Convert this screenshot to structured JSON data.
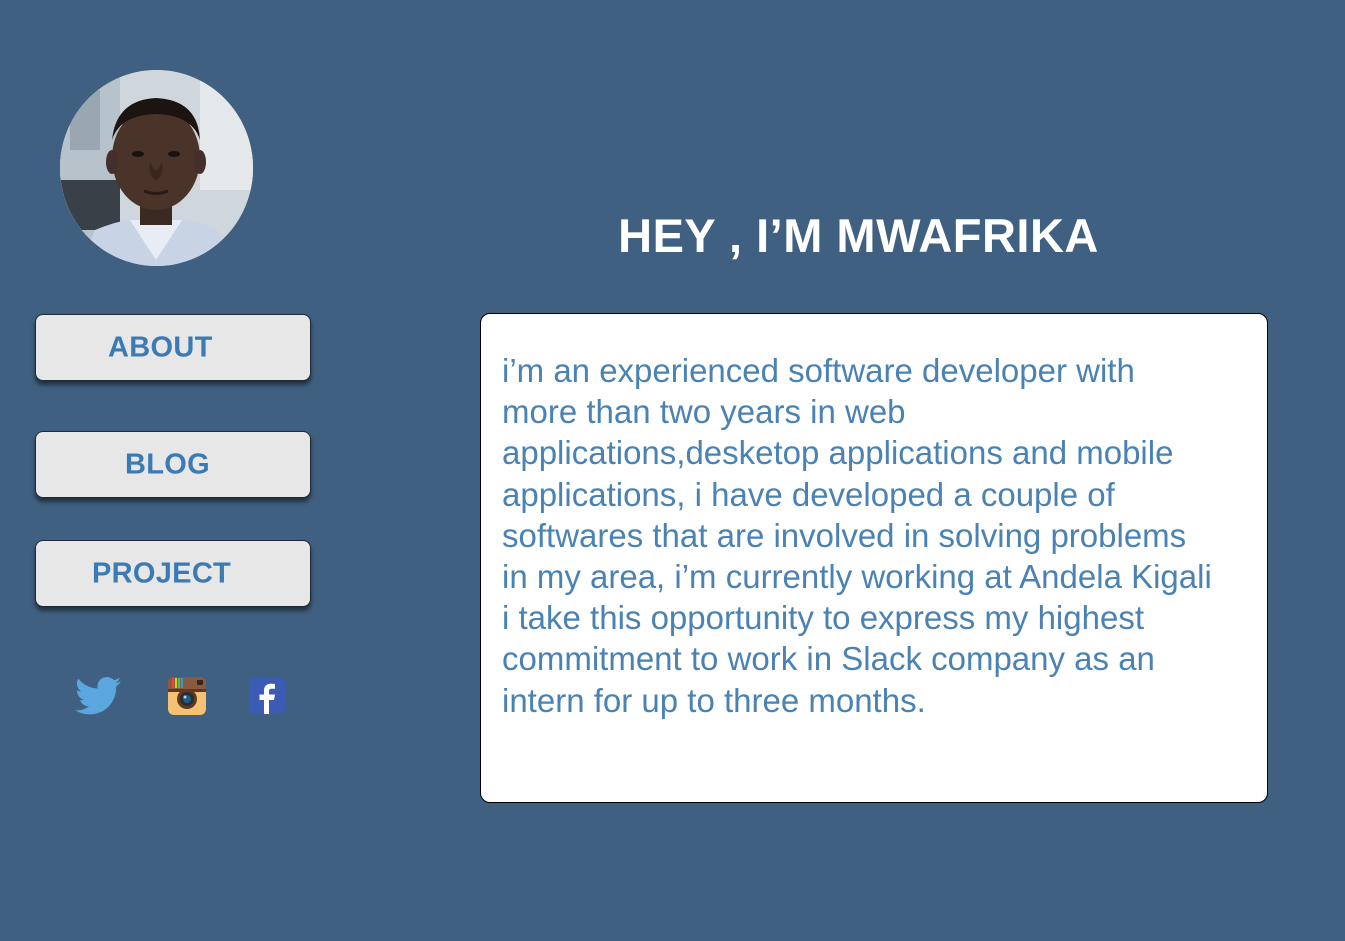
{
  "profile": {
    "headline": "HEY , I’M MWAFRIKA",
    "bio": "i’m an experienced software developer with\nmore than two years in web\napplications,desketop applications and mobile\napplications, i have developed a couple of\nsoftwares that are involved in solving problems\nin my area, i’m currently working at Andela Kigali\ni take this opportunity to express my highest\ncommitment to work in Slack company as an\nintern for up to three months."
  },
  "nav": {
    "about_label": "ABOUT",
    "blog_label": "BLOG",
    "project_label": "PROJECT"
  },
  "social": {
    "twitter": "twitter-icon",
    "instagram": "instagram-icon",
    "facebook": "facebook-icon"
  },
  "colors": {
    "background": "#406082",
    "button_text": "#3b7bb3",
    "bio_text": "#4a82b4",
    "headline_text": "#ffffff"
  }
}
